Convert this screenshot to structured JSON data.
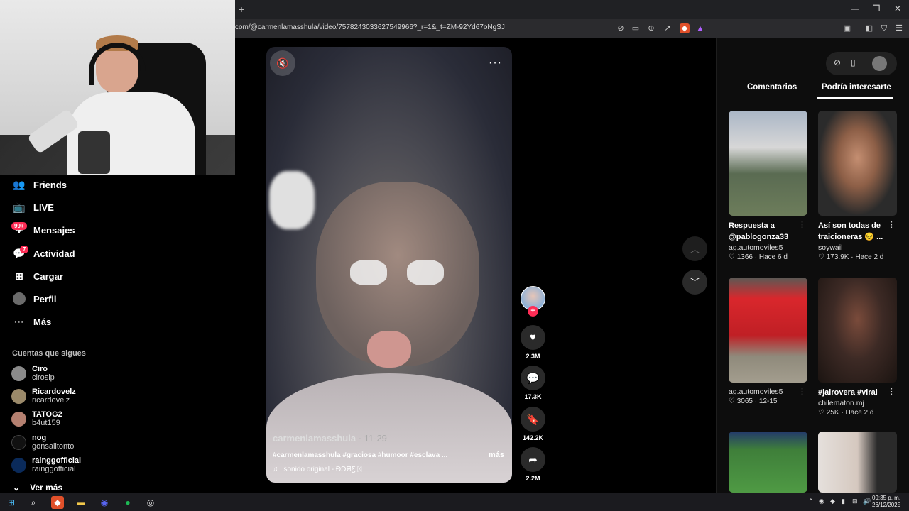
{
  "browser": {
    "url": "com/@carmenlamasshula/video/7578243033627549966?_r=1&_t=ZM-92Yd67oNgSJ",
    "new_tab": "+",
    "window_controls": [
      "—",
      "❐",
      "✕"
    ]
  },
  "sidebar": {
    "items": [
      {
        "label": "Friends",
        "icon": "friends-icon",
        "glyph": "👥"
      },
      {
        "label": "LIVE",
        "icon": "live-icon",
        "glyph": "📺"
      },
      {
        "label": "Mensajes",
        "icon": "messages-icon",
        "glyph": "✈",
        "badge": "99+"
      },
      {
        "label": "Actividad",
        "icon": "activity-icon",
        "glyph": "💬",
        "badge": "7"
      },
      {
        "label": "Cargar",
        "icon": "upload-icon",
        "glyph": "⊞"
      },
      {
        "label": "Perfil",
        "icon": "profile-icon",
        "glyph": "●"
      },
      {
        "label": "Más",
        "icon": "more-icon",
        "glyph": "···"
      }
    ],
    "following_title": "Cuentas que sigues",
    "accounts": [
      {
        "name": "Ciro",
        "handle": "ciroslp"
      },
      {
        "name": "Ricardovelz",
        "handle": "ricardovelz"
      },
      {
        "name": "TATOG2",
        "handle": "b4ut159"
      },
      {
        "name": "nog",
        "handle": "gonsalitonto"
      },
      {
        "name": "rainggofficial",
        "handle": "rainggofficial"
      }
    ],
    "see_more": "Ver más"
  },
  "video": {
    "author": "carmenlamasshula",
    "date": " · 11-29",
    "caption": "#carmenlamasshula #graciosa #humoor #esclava ...",
    "more_label": "más",
    "sound": "sonido original - ĐƆЯƸ ᛞ",
    "more_options": "···"
  },
  "actions": {
    "likes": "2.3M",
    "comments": "17.3K",
    "saves": "142.2K",
    "shares": "2.2M"
  },
  "right_panel": {
    "tabs": [
      "Comentarios",
      "Podría interesarte"
    ],
    "active_tab": "Podría interesarte",
    "cards": [
      {
        "title": "Respuesta a @pablogonza33",
        "user": "ag.automoviles5",
        "likes": "1366",
        "when": "Hace 6 d"
      },
      {
        "title": "Así son todas de traicioneras 😔 ...",
        "user": "soywail",
        "likes": "173.9K",
        "when": "Hace 2 d"
      },
      {
        "title": "",
        "user": "ag.automoviles5",
        "likes": "3065",
        "when": "12-15"
      },
      {
        "title": "#jairovera #viral",
        "user": "chilematon.mj",
        "likes": "25K",
        "when": "Hace 2 d"
      }
    ]
  },
  "taskbar": {
    "time": "09:35 p. m.",
    "date": "26/12/2025"
  },
  "colors": {
    "accent": "#fe2c55",
    "background": "#000000"
  }
}
